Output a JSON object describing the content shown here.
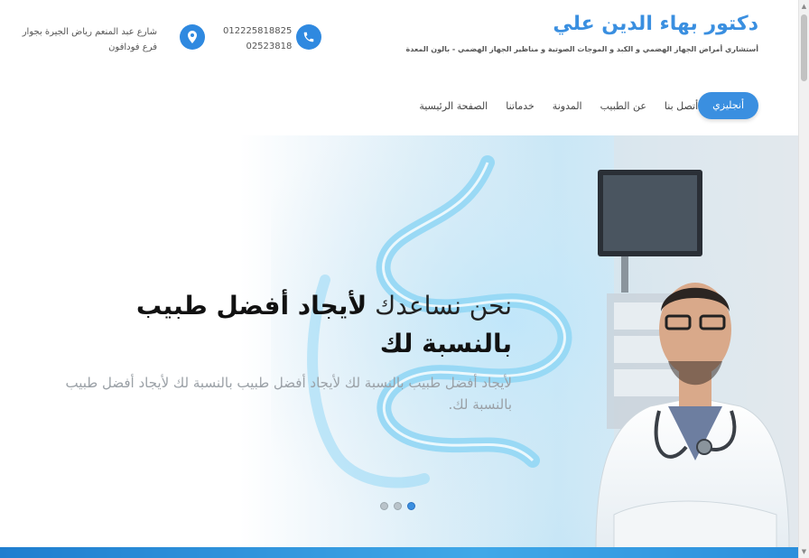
{
  "header": {
    "title": "دكتور بهاء الدين علي",
    "subtitle": "أستشاري أمراض الجهاز الهضمي و الكبد و الموجات الصوتية و مناظير الجهاز الهضمي - بالون المعدة",
    "phone_lines": [
      "012225818825",
      "02523818"
    ],
    "address_lines": [
      "شارع عبد المنعم رياض الجيرة بجوار",
      "فرع فودافون"
    ],
    "phone_icon": "phone-icon",
    "location_icon": "location-pin-icon"
  },
  "nav": {
    "items": [
      "الصفحة الرئيسية",
      "خدماتنا",
      "المدونة",
      "عن الطبيب",
      "أتصل بنا"
    ],
    "language_button": "أنجليزي"
  },
  "hero": {
    "headline_thin": "نحن نساعدك",
    "headline_bold": "لأيجاد أفضل طبيب بالنسبة لك",
    "body": "لأيجاد أفضل طبيب بالنسبة لك لأيجاد أفضل طبيب بالنسبة لك لأيجاد أفضل طبيب بالنسبة لك.",
    "slide_count": 3,
    "active_slide": 3
  },
  "colors": {
    "accent": "#3a8fe0",
    "text": "#444444"
  }
}
